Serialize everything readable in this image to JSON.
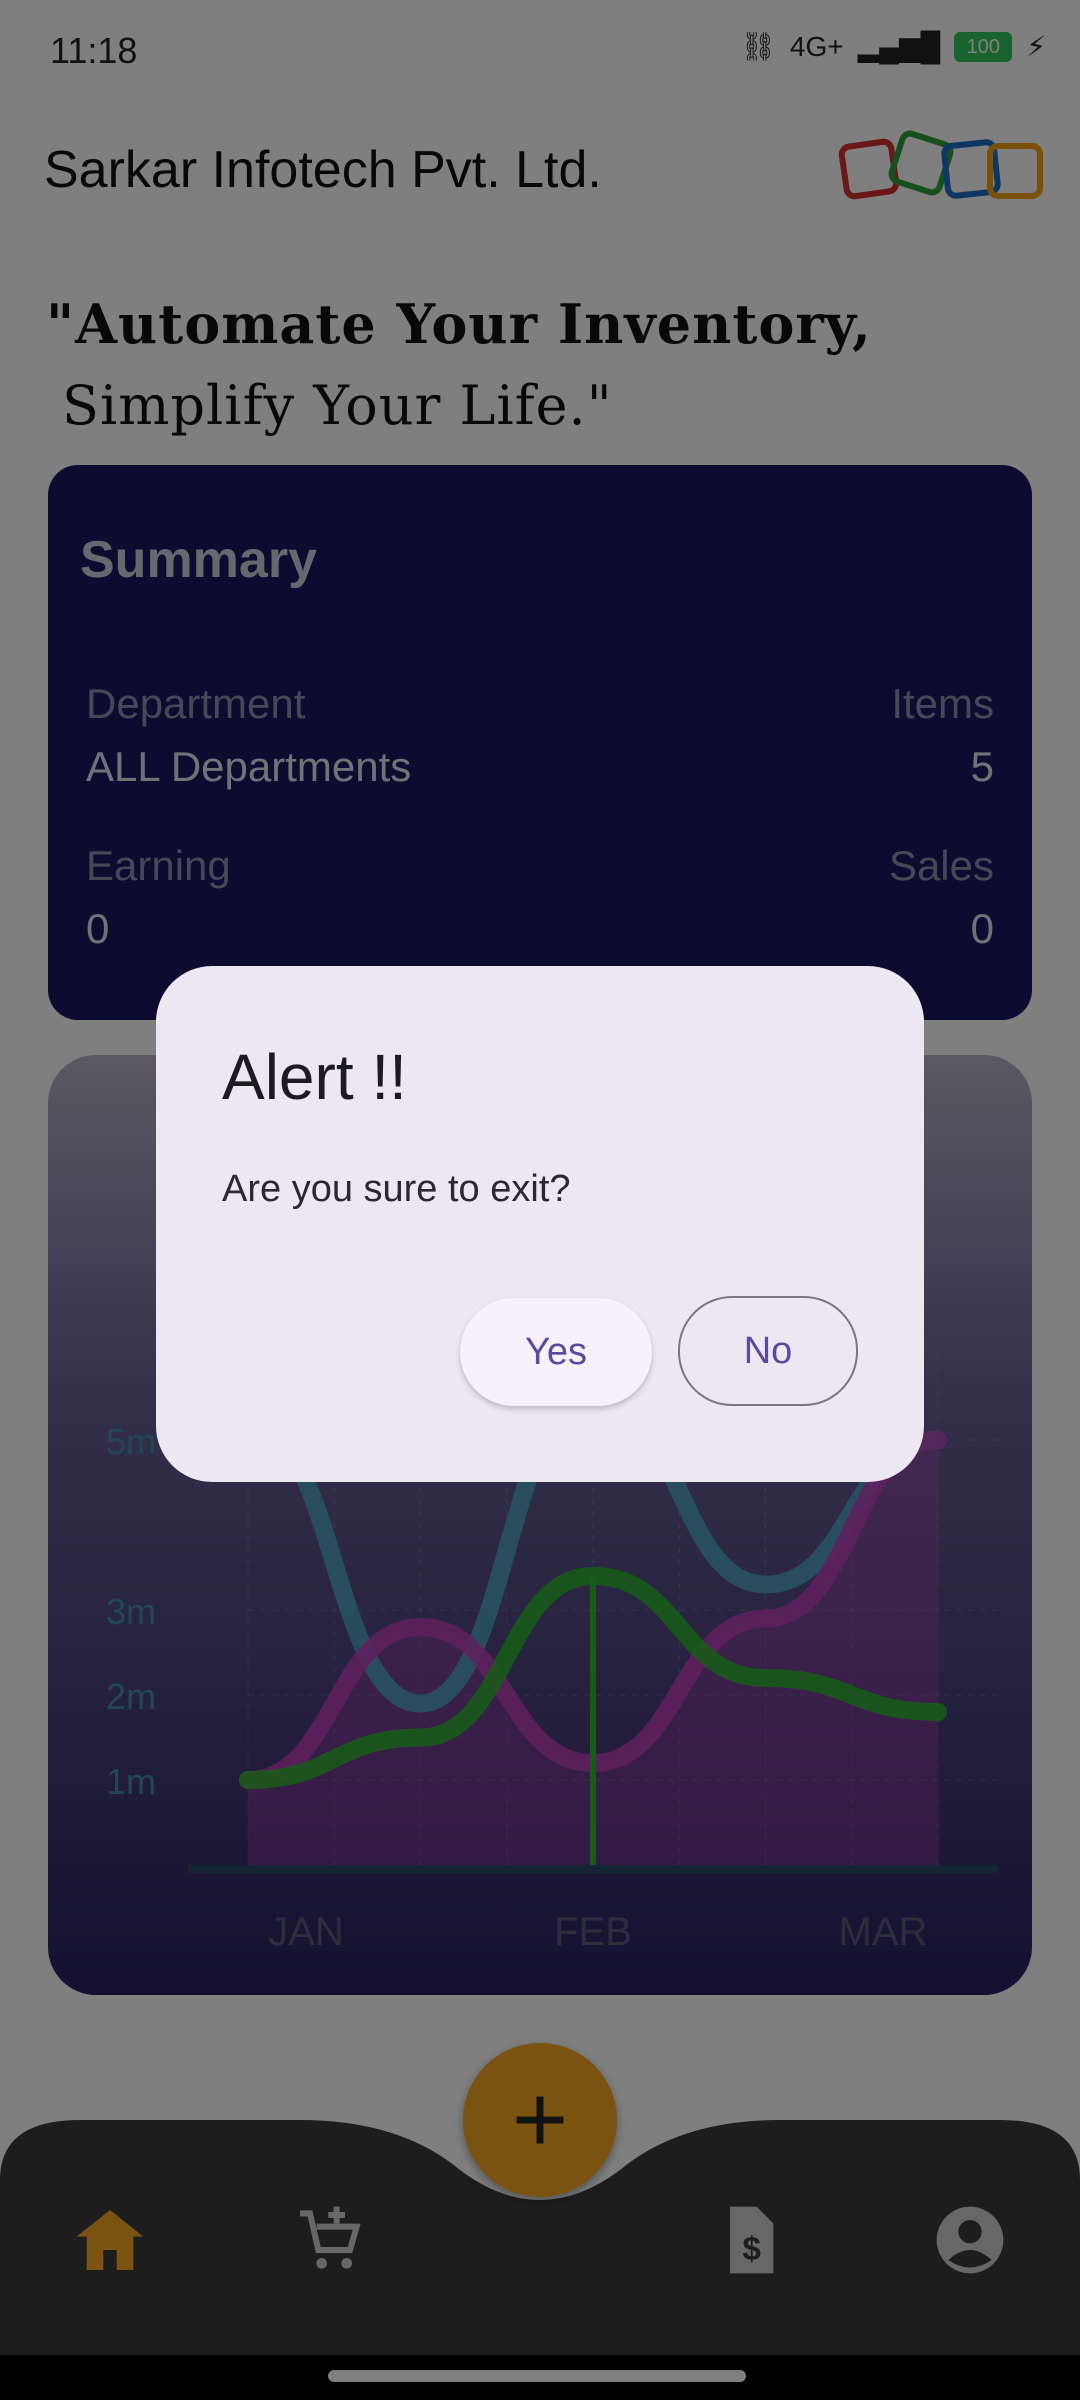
{
  "status_bar": {
    "time": "11:18",
    "battery": "100",
    "network": "4G+"
  },
  "header": {
    "app_title": "Sarkar Infotech Pvt. Ltd.",
    "logo_icon": "interlocking-squares-logo"
  },
  "tagline": {
    "line1": "\"Automate Your Inventory,",
    "line2": "Simplify Your Life.\""
  },
  "summary": {
    "title": "Summary",
    "department_label": "Department",
    "department_value": "ALL Departments",
    "items_label": "Items",
    "items_value": "5",
    "earning_label": "Earning",
    "earning_value": "0",
    "sales_label": "Sales",
    "sales_value": "0"
  },
  "chart_data": {
    "type": "line",
    "categories": [
      "JAN",
      "FEB",
      "MAR"
    ],
    "y_tick_labels": [
      "1m",
      "2m",
      "3m",
      "5m"
    ],
    "series": [
      {
        "color": "#4fa8c6",
        "values": [
          5.2,
          1.9,
          5.5,
          3.3,
          5.0
        ]
      },
      {
        "color": "#c03fbd",
        "values": [
          1.0,
          2.8,
          1.2,
          2.9,
          5.0
        ]
      },
      {
        "color": "#2db82d",
        "values": [
          1.0,
          1.5,
          3.4,
          2.2,
          1.8
        ]
      }
    ],
    "grid": true
  },
  "bottom_nav": {
    "items": [
      {
        "icon": "home-icon",
        "active": true
      },
      {
        "icon": "add-to-cart-icon",
        "active": false
      },
      {
        "icon": "invoice-dollar-icon",
        "active": false
      },
      {
        "icon": "account-circle-icon",
        "active": false
      }
    ],
    "fab_symbol": "+",
    "fab_color": "#f5a623",
    "active_color": "#f5a623"
  },
  "dialog": {
    "title": "Alert !!",
    "message": "Are you sure to exit?",
    "yes_label": "Yes",
    "no_label": "No"
  }
}
